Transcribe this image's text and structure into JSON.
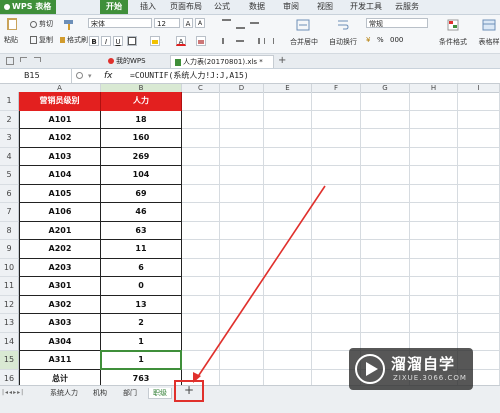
{
  "menu": {
    "app_button": "WPS 表格",
    "tabs": [
      "开始",
      "插入",
      "页面布局",
      "公式",
      "数据",
      "审阅",
      "视图",
      "开发工具",
      "云服务"
    ]
  },
  "ribbon": {
    "paste": "粘贴",
    "cut": "剪切",
    "copy": "复制",
    "format_painter": "格式刷",
    "font_name": "宋体",
    "font_size": "12",
    "bold": "B",
    "italic": "I",
    "underline": "U",
    "merge_center": "合并居中",
    "wrap_text": "自动换行",
    "number_format": "常规",
    "conditional_format": "条件格式",
    "table_style": "表格样"
  },
  "doc_tabs": {
    "home": "我的WPS",
    "file": "人力表(20170801).xls *"
  },
  "formula_bar": {
    "name_box": "B15",
    "fx": "fx",
    "formula": "=COUNTIF(系统人力!J:J,A15)"
  },
  "columns": [
    "A",
    "B",
    "C",
    "D",
    "E",
    "F",
    "G",
    "H",
    "I"
  ],
  "table": {
    "header": [
      "营销员级别",
      "人力"
    ],
    "rows": [
      [
        "A101",
        "18"
      ],
      [
        "A102",
        "160"
      ],
      [
        "A103",
        "269"
      ],
      [
        "A104",
        "104"
      ],
      [
        "A105",
        "69"
      ],
      [
        "A106",
        "46"
      ],
      [
        "A201",
        "63"
      ],
      [
        "A202",
        "11"
      ],
      [
        "A203",
        "6"
      ],
      [
        "A301",
        "0"
      ],
      [
        "A302",
        "13"
      ],
      [
        "A303",
        "2"
      ],
      [
        "A304",
        "1"
      ],
      [
        "A311",
        "1"
      ],
      [
        "总计",
        "763"
      ]
    ]
  },
  "row_numbers": [
    "1",
    "2",
    "3",
    "4",
    "5",
    "6",
    "7",
    "8",
    "9",
    "10",
    "11",
    "12",
    "13",
    "14",
    "15",
    "16"
  ],
  "sheet_tabs": [
    "系统人力",
    "机构",
    "部门",
    "职级"
  ],
  "add_sheet": "+",
  "watermark": {
    "title": "溜溜自学",
    "url": "ZIXUE.3066.COM"
  },
  "colors": {
    "accent_green": "#3f8f3a",
    "header_red": "#e3201f",
    "annotation_red": "#e0302c"
  }
}
